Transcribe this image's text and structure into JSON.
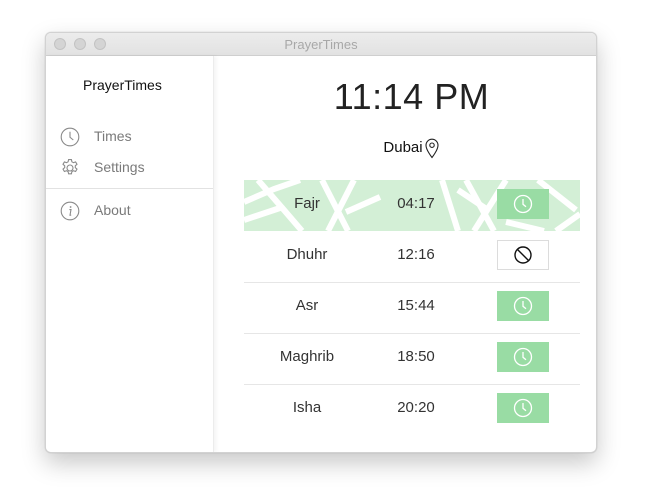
{
  "window": {
    "title": "PrayerTimes"
  },
  "sidebar": {
    "app_name": "PrayerTimes",
    "items": [
      {
        "label": "Times",
        "icon": "clock-icon"
      },
      {
        "label": "Settings",
        "icon": "gear-icon"
      },
      {
        "label": "About",
        "icon": "info-icon"
      }
    ]
  },
  "main": {
    "current_time": "11:14 PM",
    "location": "Dubai",
    "prayers": [
      {
        "name": "Fajr",
        "time": "04:17",
        "alarm": "on",
        "current": true
      },
      {
        "name": "Dhuhr",
        "time": "12:16",
        "alarm": "off",
        "current": false
      },
      {
        "name": "Asr",
        "time": "15:44",
        "alarm": "on",
        "current": false
      },
      {
        "name": "Maghrib",
        "time": "18:50",
        "alarm": "on",
        "current": false
      },
      {
        "name": "Isha",
        "time": "20:20",
        "alarm": "on",
        "current": false
      }
    ]
  },
  "colors": {
    "toggle_on": "#99dca4",
    "active_row": "#d3efd6",
    "sidebar_text": "#7a7a7a"
  }
}
